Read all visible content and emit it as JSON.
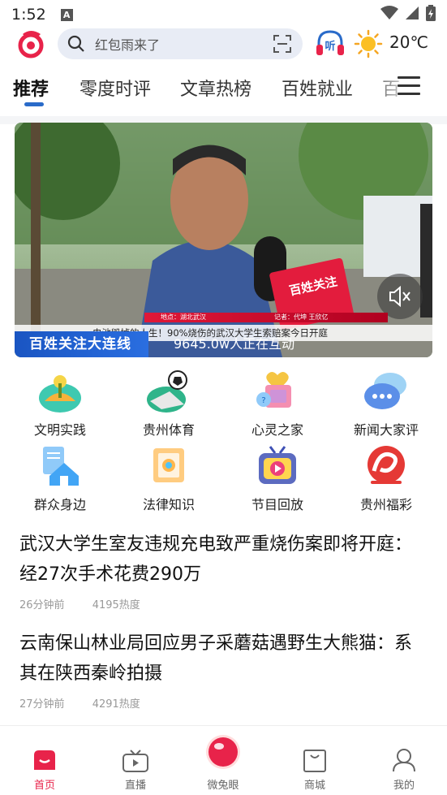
{
  "status_bar": {
    "time": "1:52",
    "notification_letter": "A"
  },
  "header": {
    "search_placeholder": "红包雨来了",
    "listen_label": "听",
    "temperature": "20℃"
  },
  "tabs": [
    {
      "label": "推荐",
      "active": true
    },
    {
      "label": "零度时评",
      "active": false
    },
    {
      "label": "文章热榜",
      "active": false
    },
    {
      "label": "百姓就业",
      "active": false
    },
    {
      "label": "百",
      "active": false
    }
  ],
  "video": {
    "caption": "电池毁掉的人生！90%烧伤的武汉大学生索赔案今日开庭",
    "caption_location": "地点：湖北武汉",
    "caption_reporter": "记者：代坤 王欣亿",
    "brand": "百姓关注大连线",
    "viewers": "9645.0w人正在互动",
    "mic_tag": "百姓关注",
    "accent_red": "#e31c3d",
    "accent_blue": "#1a55c2"
  },
  "grid": [
    {
      "label": "文明实践",
      "icon": "civilization-practice-icon"
    },
    {
      "label": "贵州体育",
      "icon": "sports-icon"
    },
    {
      "label": "心灵之家",
      "icon": "heart-home-icon"
    },
    {
      "label": "新闻大家评",
      "icon": "news-comment-icon"
    },
    {
      "label": "群众身边",
      "icon": "community-icon"
    },
    {
      "label": "法律知识",
      "icon": "law-icon"
    },
    {
      "label": "节目回放",
      "icon": "replay-icon"
    },
    {
      "label": "贵州福彩",
      "icon": "lottery-icon"
    }
  ],
  "news": [
    {
      "title": "武汉大学生室友违规充电致严重烧伤案即将开庭：经27次手术花费290万",
      "time": "26分钟前",
      "heat": "4195热度"
    },
    {
      "title": "云南保山林业局回应男子采蘑菇遇野生大熊猫：系其在陕西秦岭拍摄",
      "time": "27分钟前",
      "heat": "4291热度"
    }
  ],
  "bottom_nav": [
    {
      "label": "首页",
      "icon": "home-icon",
      "active": true
    },
    {
      "label": "直播",
      "icon": "tv-icon",
      "active": false
    },
    {
      "label": "微兔眼",
      "icon": "rabbit-eye-icon",
      "active": false
    },
    {
      "label": "商城",
      "icon": "shopping-bag-icon",
      "active": false
    },
    {
      "label": "我的",
      "icon": "profile-icon",
      "active": false
    }
  ],
  "colors": {
    "brand_red": "#e8234a",
    "tab_underline": "#2a6bc9",
    "search_bg": "#e8ecf5"
  }
}
